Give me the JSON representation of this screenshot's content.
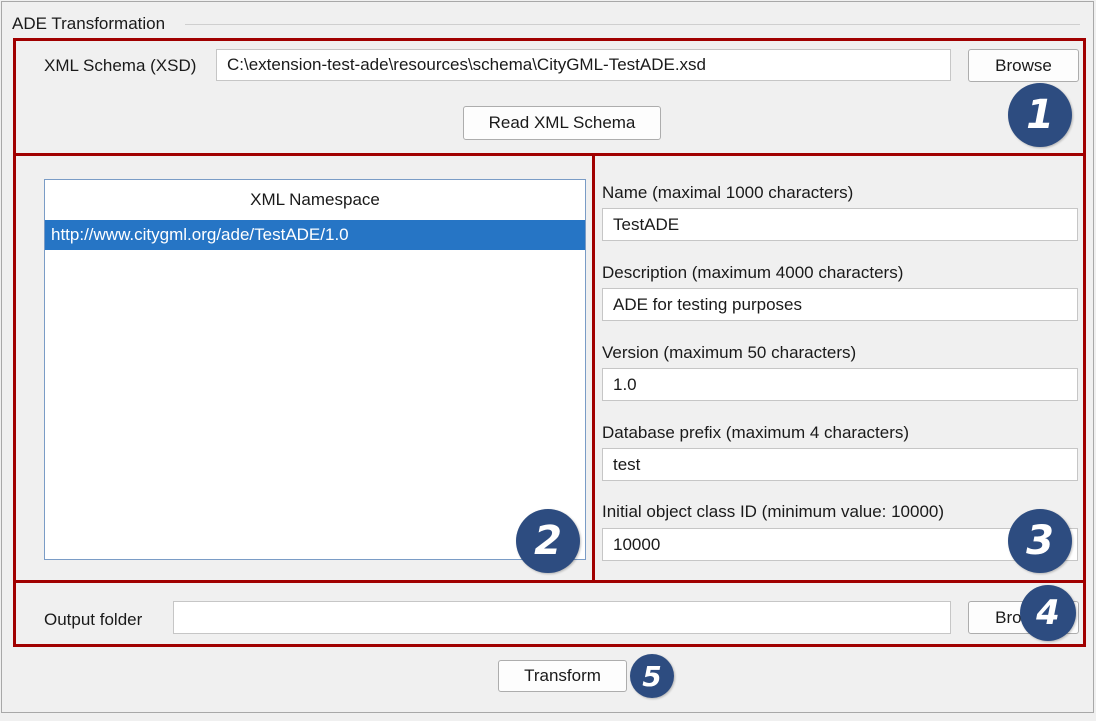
{
  "group_title": "ADE Transformation",
  "schema": {
    "label": "XML Schema (XSD)",
    "path": "C:\\extension-test-ade\\resources\\schema\\CityGML-TestADE.xsd",
    "browse_label": "Browse",
    "read_button": "Read XML Schema"
  },
  "namespace_list": {
    "header": "XML Namespace",
    "items": [
      "http://www.citygml.org/ade/TestADE/1.0"
    ],
    "selected_index": 0
  },
  "metadata": {
    "name_label": "Name (maximal 1000 characters)",
    "name_value": "TestADE",
    "description_label": "Description (maximum 4000 characters)",
    "description_value": "ADE for testing purposes",
    "version_label": "Version (maximum 50 characters)",
    "version_value": "1.0",
    "prefix_label": "Database prefix (maximum 4 characters)",
    "prefix_value": "test",
    "classid_label": "Initial object class ID (minimum value: 10000)",
    "classid_value": "10000"
  },
  "output": {
    "label": "Output folder",
    "value": "",
    "browse_label": "Browse"
  },
  "transform_label": "Transform",
  "annotations": {
    "badge_1": "1",
    "badge_2": "2",
    "badge_3": "3",
    "badge_4": "4",
    "badge_5": "5",
    "highlight_color": "#a00000",
    "badge_color": "#2d4c80"
  },
  "colors": {
    "selection": "#2675c5",
    "background": "#f0f0f0"
  }
}
